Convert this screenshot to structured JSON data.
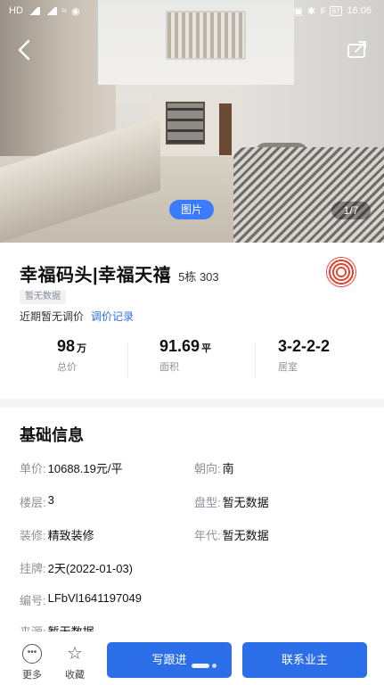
{
  "status_bar": {
    "left": "HD",
    "battery": "87",
    "time": "16:06"
  },
  "photo": {
    "tag_label": "图片",
    "counter": "1/7"
  },
  "listing": {
    "title": "幸福码头|幸福天禧",
    "unit": "5栋  303",
    "badge": "暂无数据",
    "price_note": "近期暂无调价",
    "price_link": "调价记录"
  },
  "stats": [
    {
      "value": "98",
      "unit": "万",
      "label": "总价"
    },
    {
      "value": "91.69",
      "unit": "平",
      "label": "面积"
    },
    {
      "value": "3-2-2-2",
      "unit": "",
      "label": "居室"
    }
  ],
  "basic_info": {
    "title": "基础信息",
    "unit_price_label": "单价:",
    "unit_price": "10688.19元/平",
    "orientation_label": "朝向:",
    "orientation": "南",
    "floor_label": "楼层:",
    "floor": "3",
    "layout_label": "盘型:",
    "layout": "暂无数据",
    "decoration_label": "装修:",
    "decoration": "精致装修",
    "year_label": "年代:",
    "year": "暂无数据",
    "listed_label": "挂牌:",
    "listed": "2天(2022-01-03)",
    "code_label": "编号:",
    "code": "LFbVl1641197049",
    "source_label": "来源:",
    "source": "暂无数据"
  },
  "bottom_bar": {
    "more_label": "更多",
    "favorite_label": "收藏",
    "follow_label": "写跟进",
    "contact_label": "联系业主"
  },
  "colors": {
    "accent": "#2b6ee8",
    "link": "#2d6fe6",
    "badge_bg": "#f1f2f4"
  }
}
